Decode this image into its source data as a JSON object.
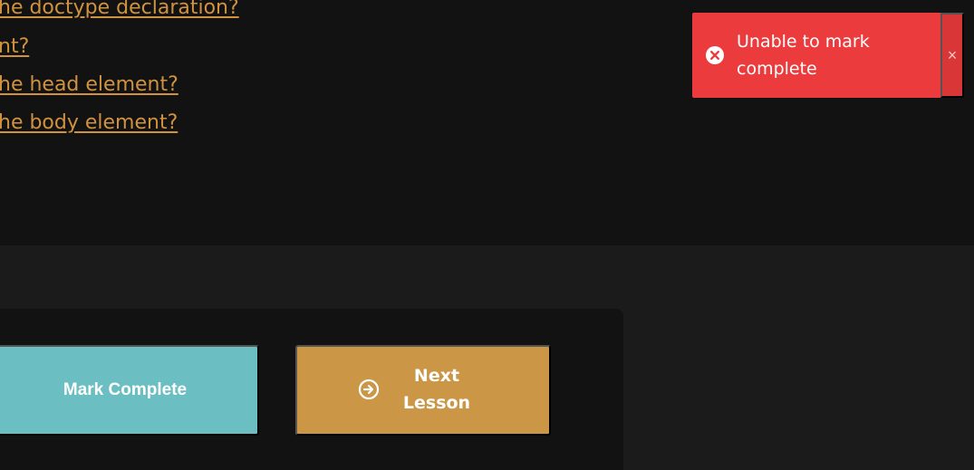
{
  "lesson_links": [
    "he doctype declaration?",
    "nt?",
    "he head element?",
    "he body element?"
  ],
  "buttons": {
    "mark_complete": "Mark Complete",
    "next_lesson": "Next Lesson"
  },
  "toast": {
    "message": "Unable to mark complete",
    "close": "×",
    "status_icon": "error-x-icon"
  },
  "colors": {
    "page_background": "#121212",
    "lower_background": "#1b1b1b",
    "link_color": "#D0923F",
    "mark_complete_button": "#6BBFC2",
    "next_lesson_button": "#CB9645",
    "toast_error": "#EC3B3D",
    "text_white": "#ffffff"
  },
  "icons": {
    "next_lesson": "arrow-circle-right-icon",
    "toast_error": "x-circle-icon"
  }
}
